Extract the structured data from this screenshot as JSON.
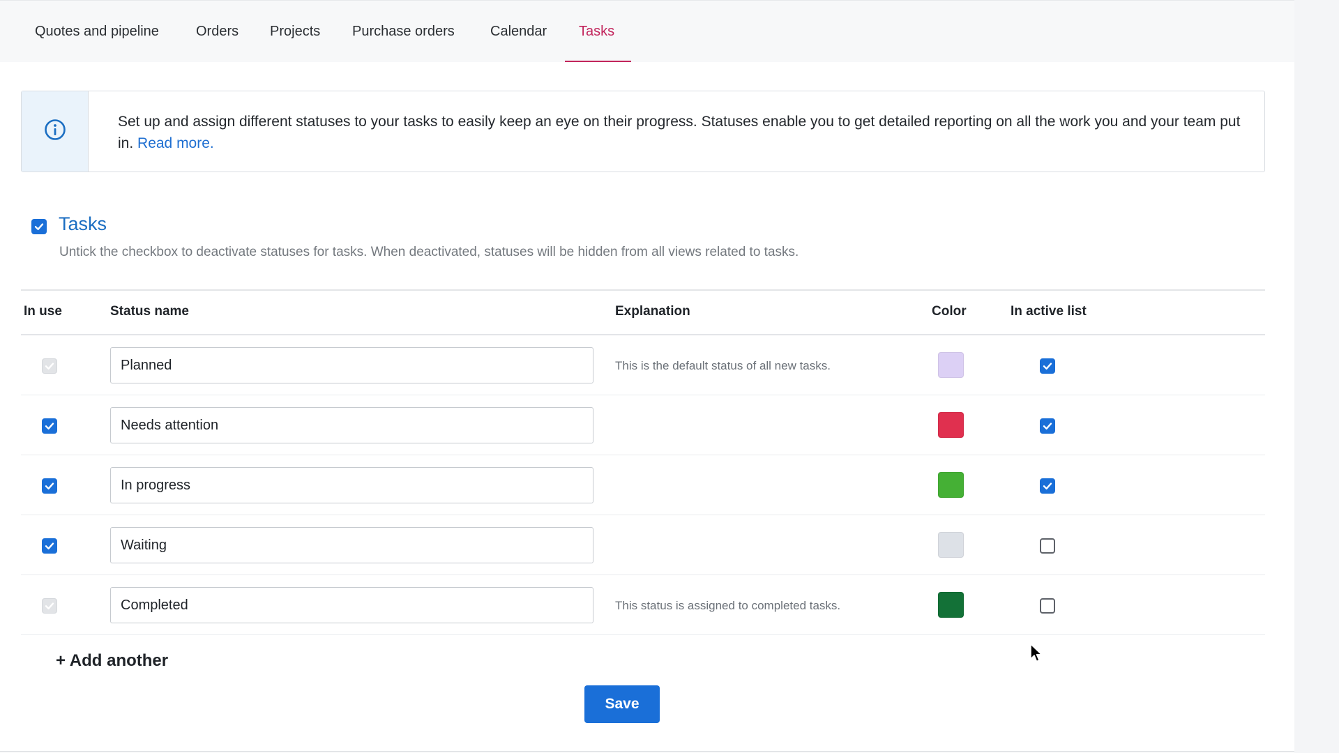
{
  "nav": {
    "tabs": [
      {
        "label": "Quotes and pipeline"
      },
      {
        "label": "Orders"
      },
      {
        "label": "Projects"
      },
      {
        "label": "Purchase orders"
      },
      {
        "label": "Calendar"
      },
      {
        "label": "Tasks",
        "active": true
      }
    ]
  },
  "info": {
    "icon": "info-icon",
    "text": "Set up and assign different statuses to your tasks to easily keep an eye on their progress. Statuses enable you to get detailed reporting on all the work you and your team put in.",
    "link": "Read more."
  },
  "section": {
    "checked": true,
    "title": "Tasks",
    "description": "Untick the checkbox to deactivate statuses for tasks. When deactivated, statuses will be hidden from all views related to tasks."
  },
  "table": {
    "headers": {
      "in_use": "In use",
      "status_name": "Status name",
      "explanation": "Explanation",
      "color": "Color",
      "in_active_list": "In active list"
    },
    "rows": [
      {
        "in_use": "disabled",
        "name": "Planned",
        "explanation": "This is the default status of all new tasks.",
        "color": "#dcd0f5",
        "in_active_list": true
      },
      {
        "in_use": "checked",
        "name": "Needs attention",
        "explanation": "",
        "color": "#e0304f",
        "in_active_list": true
      },
      {
        "in_use": "checked",
        "name": "In progress",
        "explanation": "",
        "color": "#45b035",
        "in_active_list": true
      },
      {
        "in_use": "checked",
        "name": "Waiting",
        "explanation": "",
        "color": "#dde1e7",
        "in_active_list": false
      },
      {
        "in_use": "disabled",
        "name": "Completed",
        "explanation": "This status is assigned to completed tasks.",
        "color": "#137137",
        "in_active_list": false
      }
    ]
  },
  "actions": {
    "add_another": "+ Add another",
    "save": "Save"
  },
  "colors": {
    "accent": "#1a6fd8",
    "active_tab": "#c2255c",
    "link": "#1f6fd1"
  }
}
